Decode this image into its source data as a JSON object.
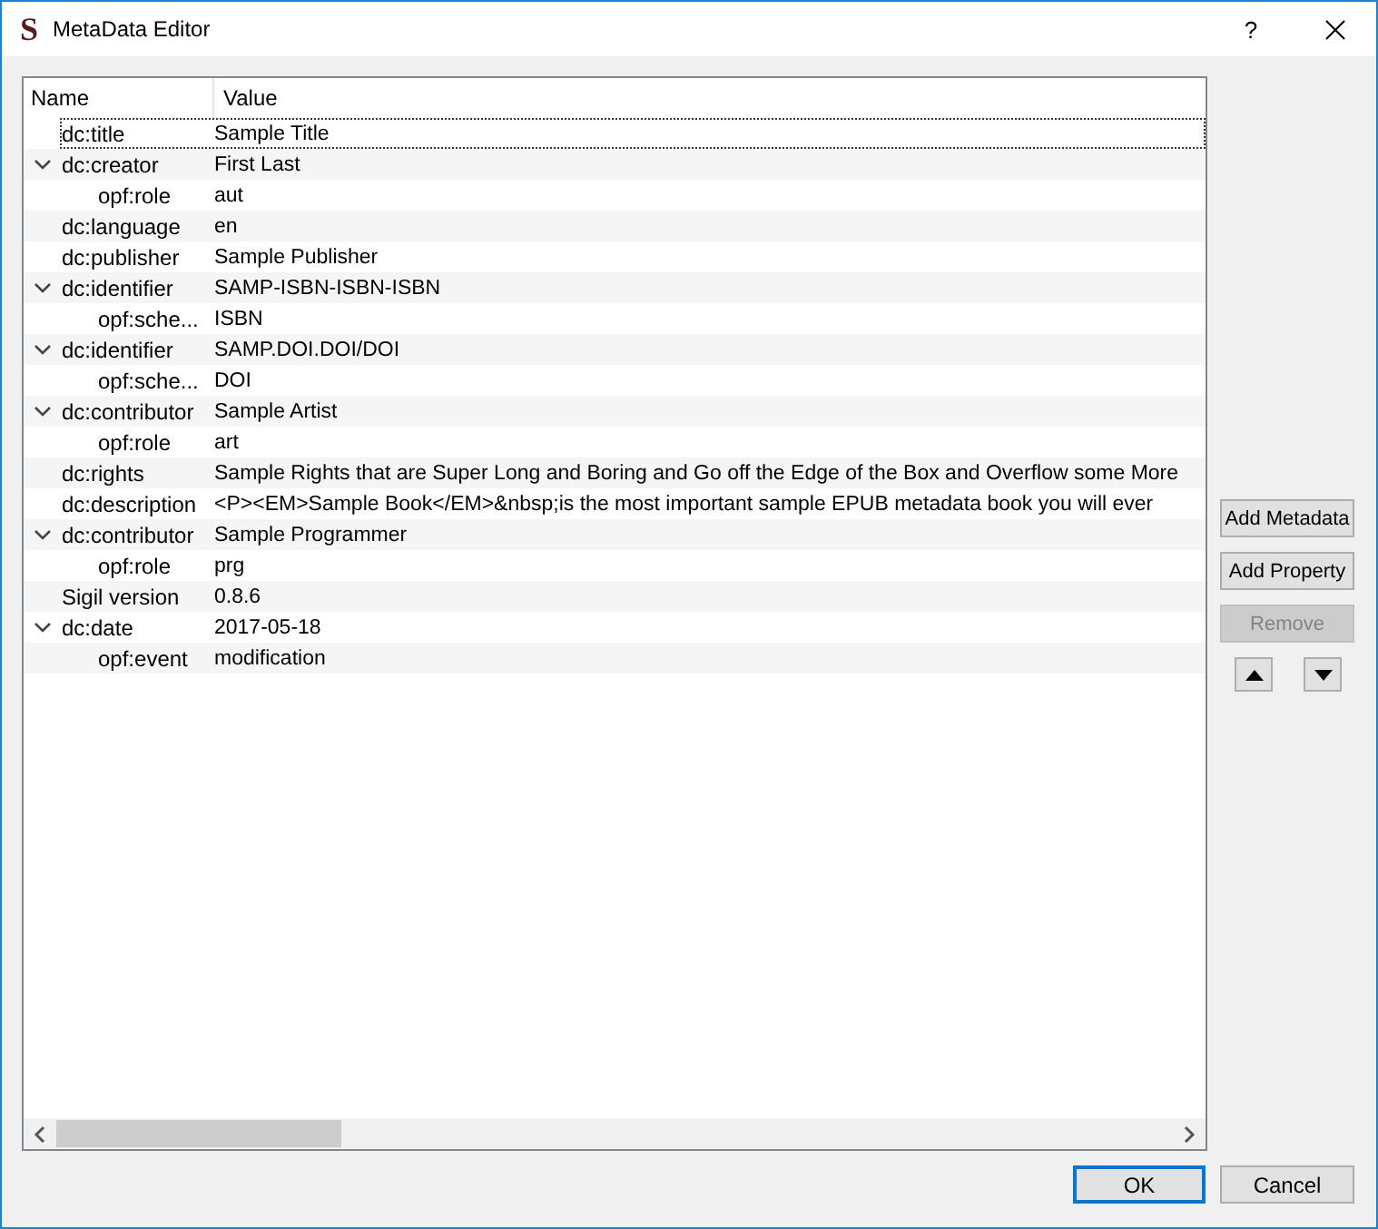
{
  "window": {
    "app_icon": "S",
    "title": "MetaData Editor",
    "help": "?"
  },
  "tree": {
    "columns": [
      "Name",
      "Value"
    ],
    "items": [
      {
        "name": "dc:title",
        "value": "Sample Title",
        "selected": true
      },
      {
        "name": "dc:creator",
        "value": "First Last",
        "selected": false,
        "expanded": true,
        "children": [
          {
            "name": "opf:role",
            "value": "aut",
            "selected": false
          }
        ]
      },
      {
        "name": "dc:language",
        "value": "en",
        "selected": false
      },
      {
        "name": "dc:publisher",
        "value": "Sample Publisher",
        "selected": false
      },
      {
        "name": "dc:identifier",
        "value": "SAMP-ISBN-ISBN-ISBN",
        "selected": false,
        "expanded": true,
        "children": [
          {
            "name": "opf:sche...",
            "value": "ISBN",
            "selected": false
          }
        ]
      },
      {
        "name": "dc:identifier",
        "value": "SAMP.DOI.DOI/DOI",
        "selected": false,
        "expanded": true,
        "children": [
          {
            "name": "opf:sche...",
            "value": "DOI",
            "selected": false
          }
        ]
      },
      {
        "name": "dc:contributor",
        "value": "Sample Artist",
        "selected": false,
        "expanded": true,
        "children": [
          {
            "name": "opf:role",
            "value": "art",
            "selected": false
          }
        ]
      },
      {
        "name": "dc:rights",
        "value": "Sample Rights that are Super Long and Boring and Go off the Edge of the Box and Overflow some More",
        "selected": false
      },
      {
        "name": "dc:description",
        "value": "<P><EM>Sample Book</EM>&nbsp;is the most important sample EPUB metadata book you will ever",
        "selected": false
      },
      {
        "name": "dc:contributor",
        "value": "Sample Programmer",
        "selected": false,
        "expanded": true,
        "children": [
          {
            "name": "opf:role",
            "value": "prg",
            "selected": false
          }
        ]
      },
      {
        "name": "Sigil version",
        "value": "0.8.6",
        "selected": false
      },
      {
        "name": "dc:date",
        "value": "2017-05-18",
        "selected": false,
        "expanded": true,
        "children": [
          {
            "name": "opf:event",
            "value": "modification",
            "selected": false
          }
        ]
      }
    ]
  },
  "side_buttons": [
    {
      "label": "Add Metadata",
      "disabled": false
    },
    {
      "label": "Add Property",
      "disabled": false
    },
    {
      "label": "Remove",
      "disabled": true
    }
  ],
  "footer_buttons": [
    {
      "label": "OK",
      "default": true
    },
    {
      "label": "Cancel",
      "default": false
    }
  ]
}
